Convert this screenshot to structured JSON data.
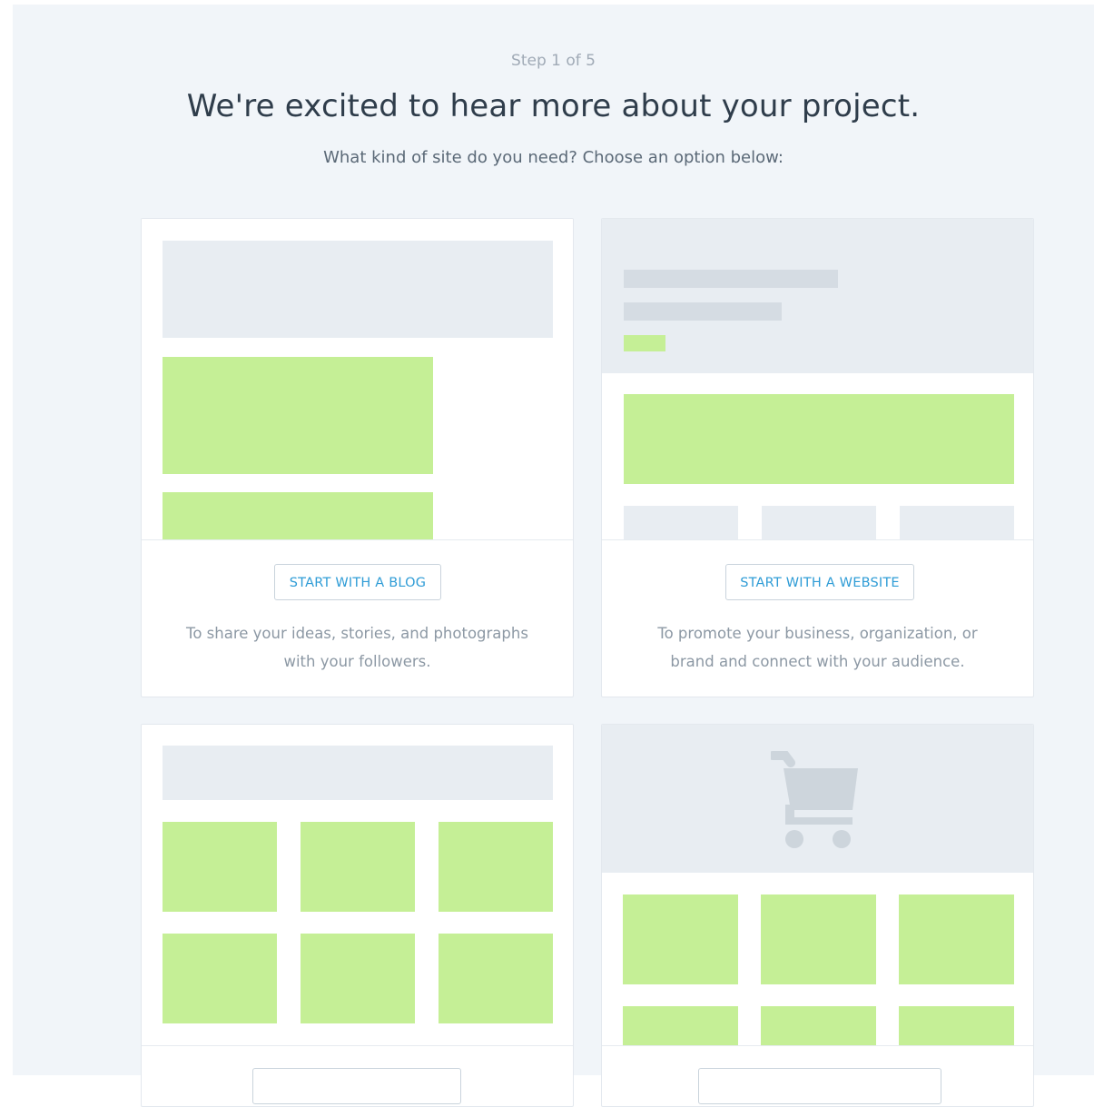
{
  "header": {
    "step": "Step 1 of 5",
    "title": "We're excited to hear more about your project.",
    "subtitle": "What kind of site do you need? Choose an option below:"
  },
  "options": [
    {
      "button_label": "START WITH A BLOG",
      "description_line1": "To share your ideas, stories, and photographs",
      "description_line2": "with your followers."
    },
    {
      "button_label": "START WITH A WEBSITE",
      "description_line1": "To promote your business, organization, or",
      "description_line2": "brand and connect with your audience."
    },
    {
      "button_label": "",
      "icon": "grid-layout"
    },
    {
      "button_label": "",
      "icon": "shopping-cart-icon"
    }
  ],
  "colors": {
    "page_background": "#f1f5f9",
    "accent_green": "#c5ef96",
    "placeholder_gray": "#e8edf2",
    "button_text": "#2f9cd6"
  }
}
